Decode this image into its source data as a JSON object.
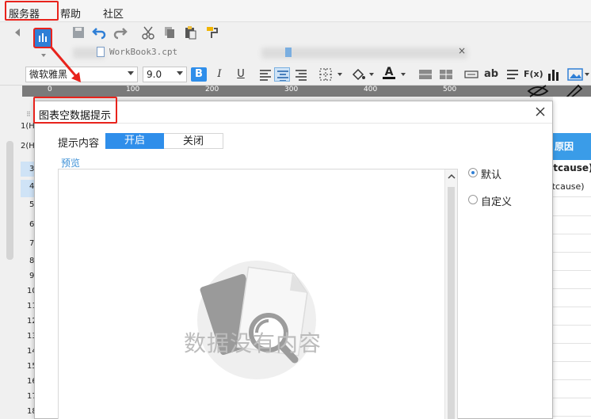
{
  "menu": {
    "items": [
      "服务器",
      "帮助",
      "社区"
    ]
  },
  "toolbar": {
    "tab_name": "WorkBook3.cpt"
  },
  "format": {
    "font_name": "微软雅黑",
    "font_size": "9.0",
    "bold": "B",
    "italic": "I",
    "underline": "U",
    "text_ab": "ab",
    "formula": "F(x)"
  },
  "ruler": {
    "marks": [
      "0",
      "100",
      "200",
      "300",
      "400",
      "500"
    ]
  },
  "rows": {
    "labels": [
      "1(H",
      "2(H",
      "3",
      "4",
      "5",
      "6",
      "7",
      "8",
      "9",
      "10",
      "11",
      "12",
      "13",
      "14",
      "15",
      "16",
      "17",
      "18"
    ]
  },
  "right_sheet": {
    "header": "原因",
    "cell1": "otcause)",
    "cell2": "otcause)"
  },
  "dialog": {
    "title": "图表空数据提示",
    "hint_label": "提示内容",
    "toggle_on": "开启",
    "toggle_off": "关闭",
    "preview_label": "预览",
    "empty_text": "数据没有内容",
    "radio_default": "默认",
    "radio_custom": "自定义",
    "selected": "默认"
  },
  "colors": {
    "accent": "#2f8eea",
    "highlight": "#e8231c"
  }
}
